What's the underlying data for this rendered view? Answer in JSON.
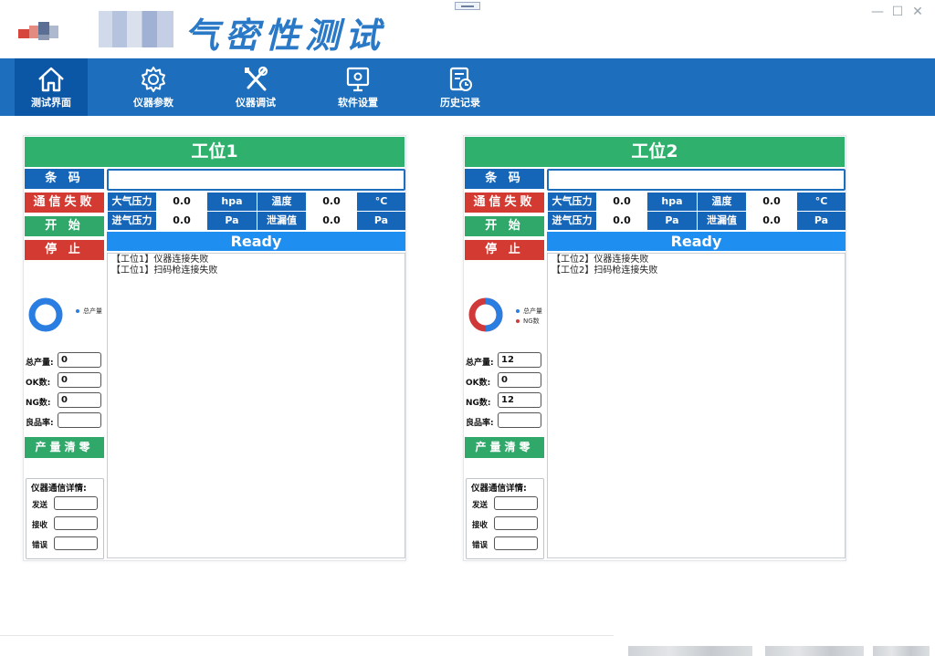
{
  "window": {
    "title": "气密性测试",
    "controls": {
      "minimize": "—",
      "maximize": "☐",
      "close": "✕"
    }
  },
  "nav": {
    "items": [
      {
        "label": "测试界面",
        "icon": "home-icon",
        "active": true
      },
      {
        "label": "仪器参数",
        "icon": "gear-icon",
        "active": false
      },
      {
        "label": "仪器调试",
        "icon": "tools-icon",
        "active": false
      },
      {
        "label": "软件设置",
        "icon": "settings-panel-icon",
        "active": false
      },
      {
        "label": "历史记录",
        "icon": "history-icon",
        "active": false
      }
    ]
  },
  "stations": [
    {
      "title": "工位1",
      "buttons": {
        "barcode": "条 码",
        "comm_status": "通信失败",
        "start": "开 始",
        "stop": "停 止",
        "clear": "产量清零"
      },
      "barcode_value": "",
      "readings": {
        "atm_label": "大气压力",
        "atm_value": "0.0",
        "atm_unit": "hpa",
        "temp_label": "温度",
        "temp_value": "0.0",
        "temp_unit": "°C",
        "inlet_label": "进气压力",
        "inlet_value": "0.0",
        "inlet_unit": "Pa",
        "leak_label": "泄漏值",
        "leak_value": "0.0",
        "leak_unit": "Pa"
      },
      "status": "Ready",
      "log": [
        "【工位1】仪器连接失败",
        "【工位1】扫码枪连接失败"
      ],
      "chart_legend": [
        "总产量"
      ],
      "stats": {
        "total_label": "总产量:",
        "total": "0",
        "ok_label": "OK数:",
        "ok": "0",
        "ng_label": "NG数:",
        "ng": "0",
        "rate_label": "良品率:",
        "rate": ""
      },
      "comm": {
        "title": "仪器通信详情:",
        "send_label": "发送",
        "recv_label": "接收",
        "err_label": "错误"
      }
    },
    {
      "title": "工位2",
      "buttons": {
        "barcode": "条 码",
        "comm_status": "通信失败",
        "start": "开 始",
        "stop": "停 止",
        "clear": "产量清零"
      },
      "barcode_value": "",
      "readings": {
        "atm_label": "大气压力",
        "atm_value": "0.0",
        "atm_unit": "hpa",
        "temp_label": "温度",
        "temp_value": "0.0",
        "temp_unit": "°C",
        "inlet_label": "进气压力",
        "inlet_value": "0.0",
        "inlet_unit": "Pa",
        "leak_label": "泄漏值",
        "leak_value": "0.0",
        "leak_unit": "Pa"
      },
      "status": "Ready",
      "log": [
        "【工位2】仪器连接失败",
        "【工位2】扫码枪连接失败"
      ],
      "chart_legend": [
        "总产量",
        "NG数"
      ],
      "stats": {
        "total_label": "总产量:",
        "total": "12",
        "ok_label": "OK数:",
        "ok": "0",
        "ng_label": "NG数:",
        "ng": "12",
        "rate_label": "良品率:",
        "rate": ""
      },
      "comm": {
        "title": "仪器通信详情:",
        "send_label": "发送",
        "recv_label": "接收",
        "err_label": "错误"
      }
    }
  ],
  "colors": {
    "nav_bg": "#1d6fbd",
    "nav_active": "#0c56a6",
    "title_green": "#2fb06c",
    "btn_blue": "#1565b8",
    "btn_red": "#d23a32",
    "btn_green": "#2fa86a",
    "ready_blue": "#1e8ef0",
    "donut_blue": "#2a7de1",
    "donut_red": "#d0393a"
  }
}
